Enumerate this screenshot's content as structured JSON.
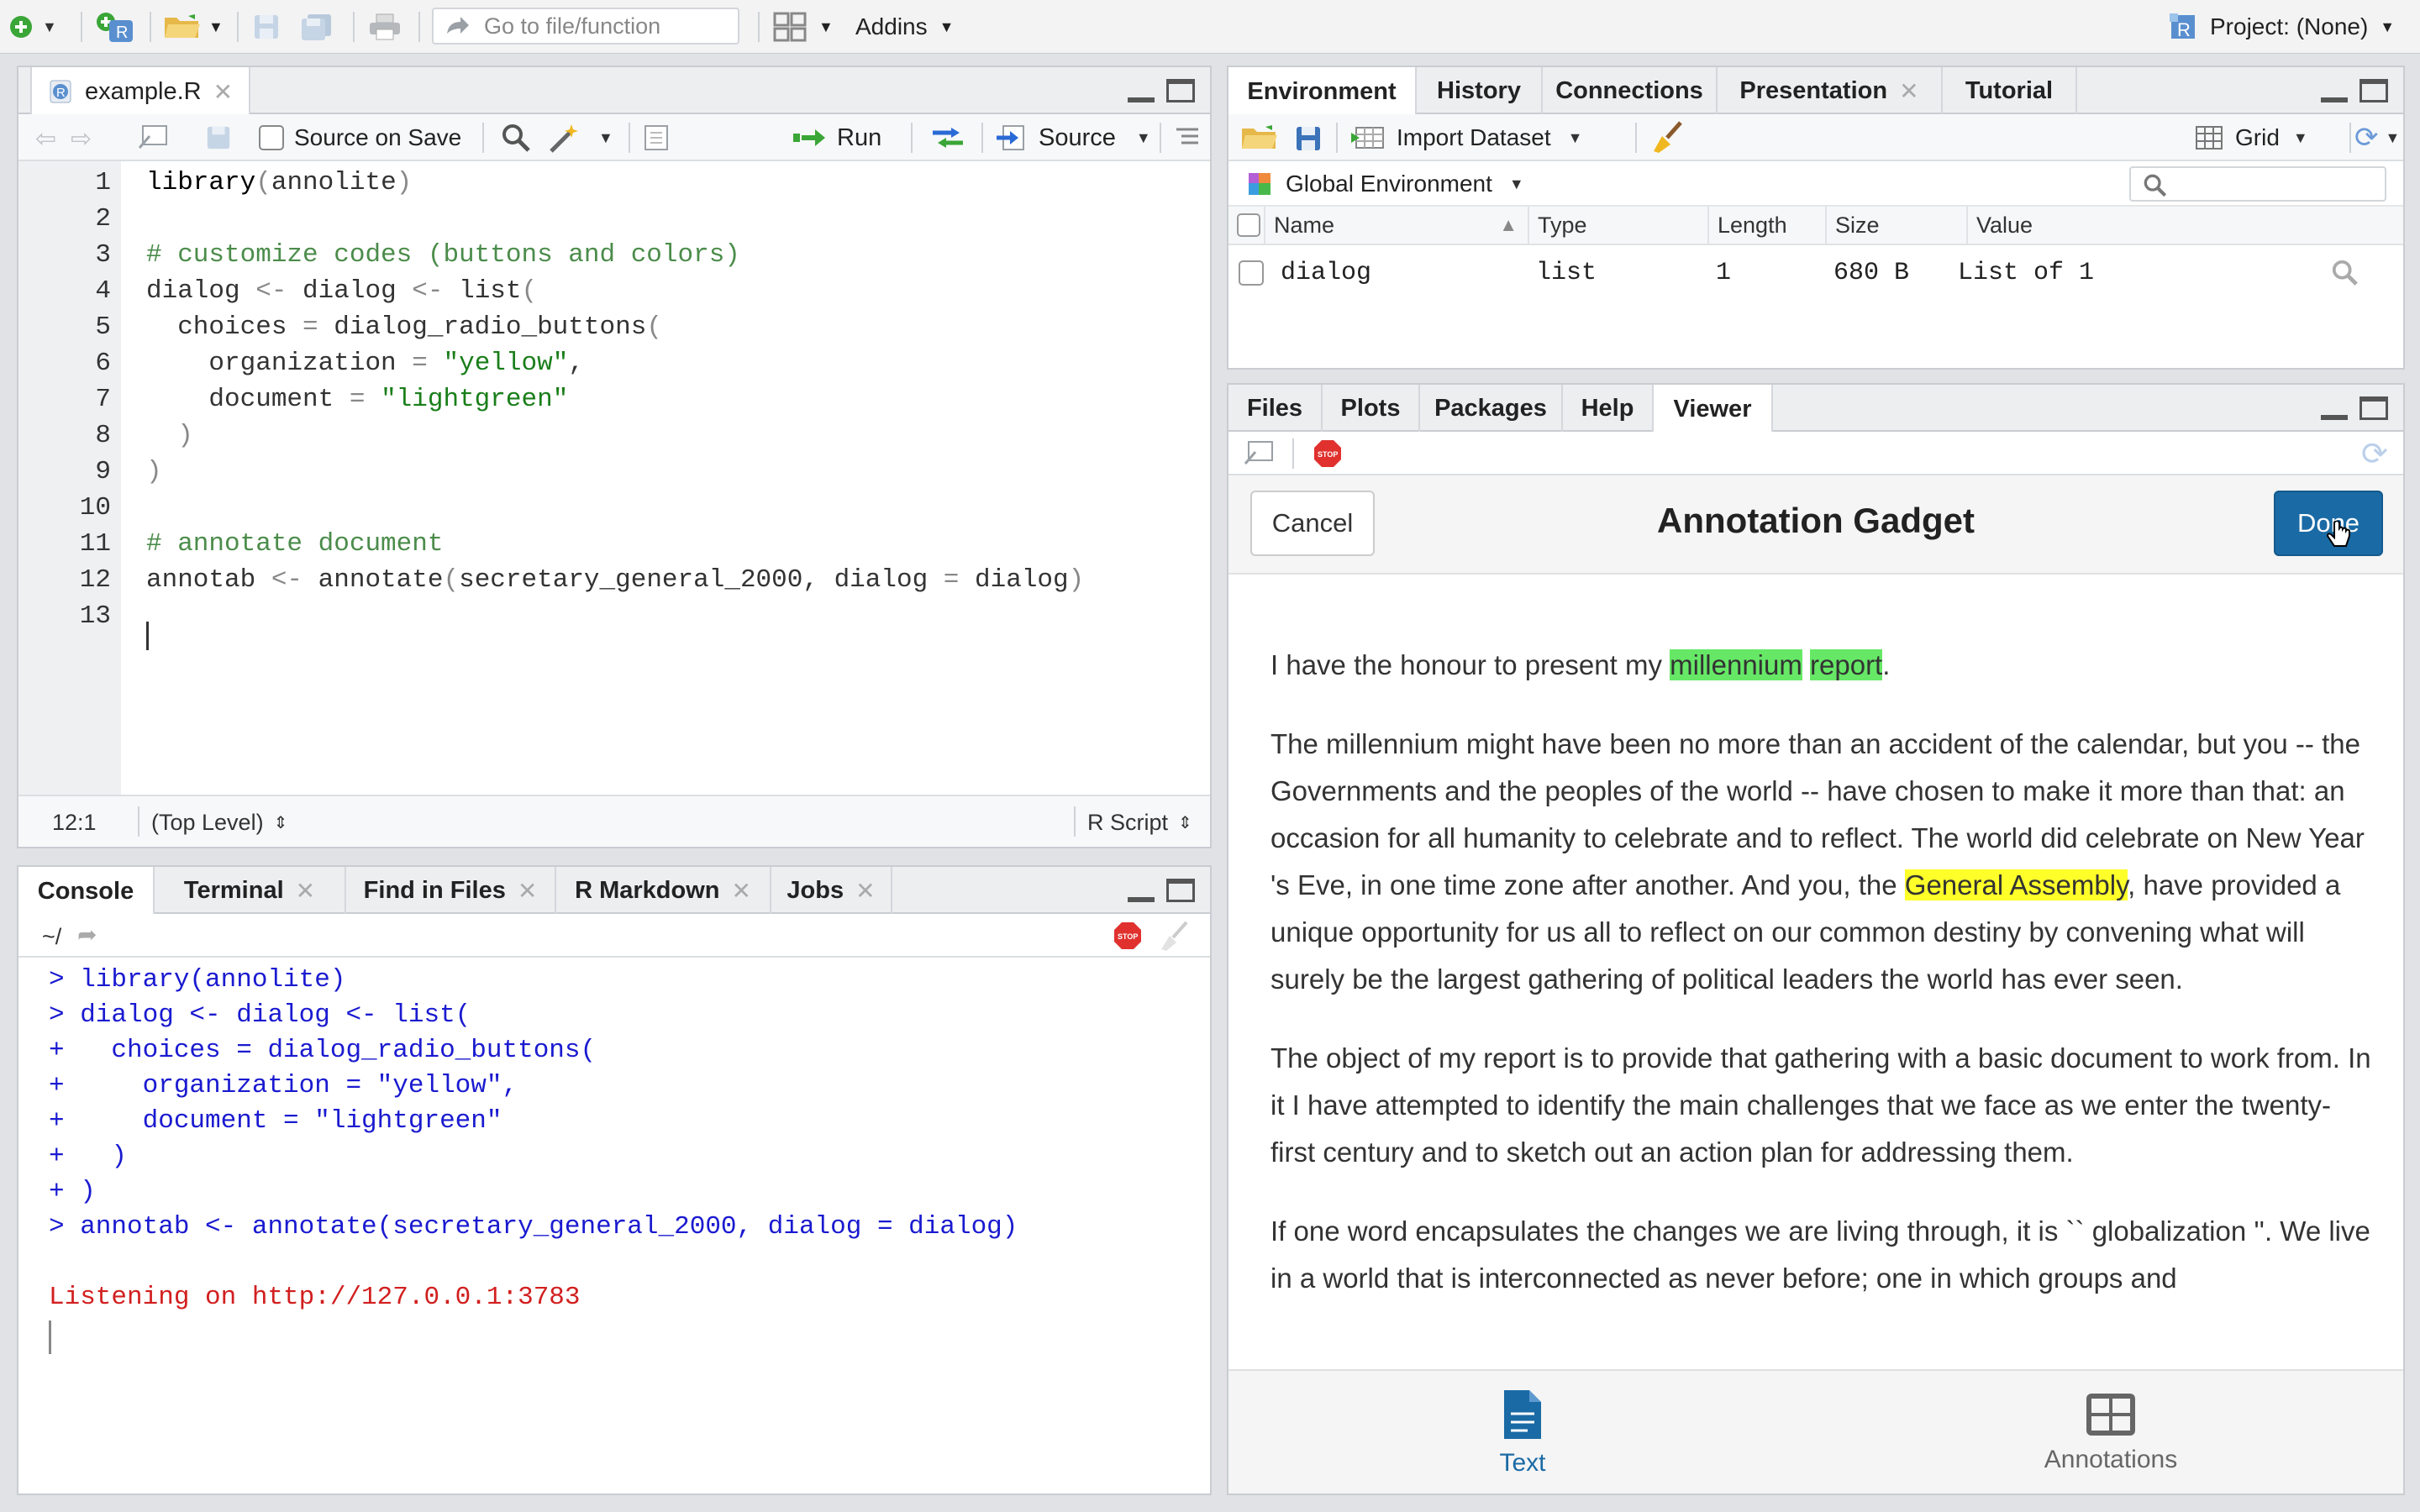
{
  "toolbar": {
    "goto_placeholder": "Go to file/function",
    "addins_label": "Addins",
    "project_label": "Project: (None)"
  },
  "editor": {
    "tab_label": "example.R",
    "source_on_save": "Source on Save",
    "run_label": "Run",
    "source_label": "Source",
    "lines": [
      {
        "n": "1",
        "html": "<span class='kw'>library</span><span class='op'>(</span>annolite<span class='op'>)</span>"
      },
      {
        "n": "2",
        "html": ""
      },
      {
        "n": "3",
        "html": "<span class='cmt'># customize codes (buttons and colors)</span>"
      },
      {
        "n": "4",
        "html": "dialog <span class='op'>&lt;-</span> dialog <span class='op'>&lt;-</span> list<span class='op'>(</span>"
      },
      {
        "n": "5",
        "html": "  choices <span class='op'>=</span> dialog_radio_buttons<span class='op'>(</span>"
      },
      {
        "n": "6",
        "html": "    organization <span class='op'>=</span> <span class='str'>\"yellow\"</span>,"
      },
      {
        "n": "7",
        "html": "    document <span class='op'>=</span> <span class='str'>\"lightgreen\"</span>"
      },
      {
        "n": "8",
        "html": "  <span class='op'>)</span>"
      },
      {
        "n": "9",
        "html": "<span class='op'>)</span>"
      },
      {
        "n": "10",
        "html": ""
      },
      {
        "n": "11",
        "html": "<span class='cmt'># annotate document</span>"
      },
      {
        "n": "12",
        "html": "annotab <span class='op'>&lt;-</span> annotate<span class='op'>(</span>secretary_general_2000, dialog <span class='op'>=</span> dialog<span class='op'>)</span>"
      },
      {
        "n": "13",
        "html": ""
      }
    ],
    "status_position": "12:1",
    "status_scope": "(Top Level)",
    "status_type": "R Script"
  },
  "console": {
    "tabs": [
      "Console",
      "Terminal",
      "Find in Files",
      "R Markdown",
      "Jobs"
    ],
    "path": "~/",
    "lines": [
      "> library(annolite)",
      "> dialog <- dialog <- list(",
      "+   choices = dialog_radio_buttons(",
      "+     organization = \"yellow\",",
      "+     document = \"lightgreen\"",
      "+   )",
      "+ )",
      "> annotab <- annotate(secretary_general_2000, dialog = dialog)"
    ],
    "listening": "Listening on http://127.0.0.1:3783"
  },
  "environment": {
    "tabs": [
      "Environment",
      "History",
      "Connections",
      "Presentation",
      "Tutorial"
    ],
    "import_label": "Import Dataset",
    "grid_label": "Grid",
    "global_env": "Global Environment",
    "columns": [
      "Name",
      "Type",
      "Length",
      "Size",
      "Value"
    ],
    "rows": [
      {
        "name": "dialog",
        "type": "list",
        "length": "1",
        "size": "680 B",
        "value": "List of 1"
      }
    ]
  },
  "viewer": {
    "tabs": [
      "Files",
      "Plots",
      "Packages",
      "Help",
      "Viewer"
    ],
    "cancel_label": "Cancel",
    "title": "Annotation Gadget",
    "done_label": "Done",
    "bottom_text": "Text",
    "bottom_annotations": "Annotations",
    "accent_color": "#1a6aa5",
    "paragraphs": [
      "I have the honour to present my <span class='hl-g'>millennium</span> <span class='hl-g'>report</span>.",
      "The millennium might have been no more than an accident of the calendar, but you -- the Governments and the peoples of the world -- have chosen to make it more than that: an occasion for all humanity to celebrate and to reflect. The world did celebrate on New Year 's Eve, in one time zone after another. And you, the <span class='hl-y'>General Assembly</span>, have provided a unique opportunity for us all to reflect on our common destiny by convening what will surely be the largest gathering of political leaders the world has ever seen.",
      "The object of my report is to provide that gathering with a basic document to work from. In it I have attempted to identify the main challenges that we face as we enter the twenty-first century and to sketch out an action plan for addressing them.",
      "If one word encapsulates the changes we are living through, it is `` globalization ''. We live in a world that is interconnected as never before; one in which groups and"
    ]
  }
}
